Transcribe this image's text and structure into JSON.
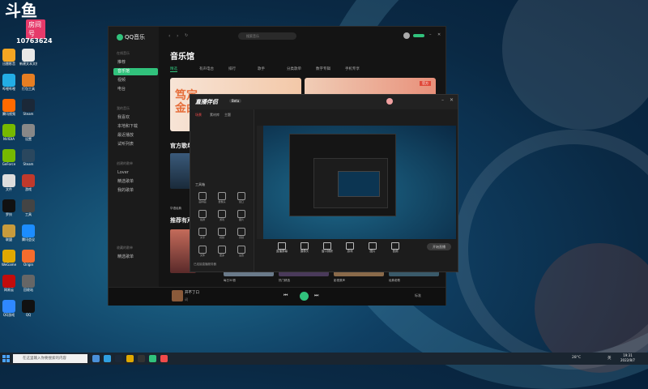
{
  "overlay": {
    "logo_text": "斗鱼",
    "badge": "房间号",
    "room_number": "10763624"
  },
  "desktop_icons": [
    {
      "label": "迅雷影音",
      "color": "#f5a623"
    },
    {
      "label": "新建文本文档",
      "color": "#e8e8e8"
    },
    {
      "label": "哔哩哔哩",
      "color": "#23ade5"
    },
    {
      "label": "打包工具",
      "color": "#e67e22"
    },
    {
      "label": "腾讯视频",
      "color": "#ff6a00"
    },
    {
      "label": "Steam",
      "color": "#1b2838"
    },
    {
      "label": "NVIDIA",
      "color": "#76b900"
    },
    {
      "label": "设置",
      "color": "#888888"
    },
    {
      "label": "GeForce",
      "color": "#76b900"
    },
    {
      "label": "Steam",
      "color": "#2a475e"
    },
    {
      "label": "文件",
      "color": "#dddddd"
    },
    {
      "label": "游戏",
      "color": "#c0392b"
    },
    {
      "label": "罗技",
      "color": "#111111"
    },
    {
      "label": "工具",
      "color": "#444444"
    },
    {
      "label": "联盟",
      "color": "#c89b3c"
    },
    {
      "label": "腾讯会议",
      "color": "#1c8dff"
    },
    {
      "label": "WeGame",
      "color": "#e0a800"
    },
    {
      "label": "Origin",
      "color": "#f56c2d"
    },
    {
      "label": "网易云",
      "color": "#c20c0c"
    },
    {
      "label": "回收站",
      "color": "#666666"
    },
    {
      "label": "QQ游戏",
      "color": "#2f88ff"
    },
    {
      "label": "QQ",
      "color": "#111111"
    }
  ],
  "qq_music": {
    "brand": "QQ音乐",
    "search_placeholder": "搜索音乐",
    "sidebar": {
      "section_online": "在线音乐",
      "online_items": [
        "推荐",
        "音乐馆",
        "视频",
        "电台"
      ],
      "section_mine": "我的音乐",
      "mine_items": [
        "我喜欢",
        "本地和下载",
        "最近播放",
        "试听列表"
      ],
      "section_created": "创建的歌单",
      "created_items": [
        "Lover",
        "精选歌单",
        "我的歌单"
      ],
      "section_collected": "收藏的歌单",
      "collected_items": [
        "精选歌单"
      ]
    },
    "title": "音乐馆",
    "tabs": [
      "精选",
      "有声电台",
      "排行",
      "歌手",
      "分类歌单",
      "数字专辑",
      "手机专享"
    ],
    "section_official": "官方歌单",
    "section_recommend": "推荐有声",
    "banner_tag": "官方",
    "card_labels": [
      "华语经典",
      "每日30首",
      "热门精选",
      "影视原声",
      "经典老歌"
    ],
    "now_playing": "开不了口",
    "lyric_label": "词",
    "quality": "标准"
  },
  "recorder": {
    "logo": "直播伴侣",
    "version": "Beta",
    "tabs": [
      "场景",
      "素材库",
      "主题"
    ],
    "tools": [
      "画中画",
      "摄像头",
      "窗口",
      "截屏",
      "游戏",
      "图片",
      "文字",
      "视频",
      "音频",
      "文件",
      "更多",
      "设置"
    ],
    "toolbox_label": "工具箱",
    "bottom_buttons": [
      "直播屏幕",
      "摄像头",
      "窗口捕获",
      "游戏",
      "图片",
      "音频"
    ],
    "start_live": "开始直播",
    "footer_text": "已连接直播服务器"
  },
  "taskbar": {
    "search_placeholder": "在这里输入你要搜索的内容",
    "temp": "28°C",
    "ime": "英",
    "time": "19:31",
    "date": "2022/8/7"
  }
}
